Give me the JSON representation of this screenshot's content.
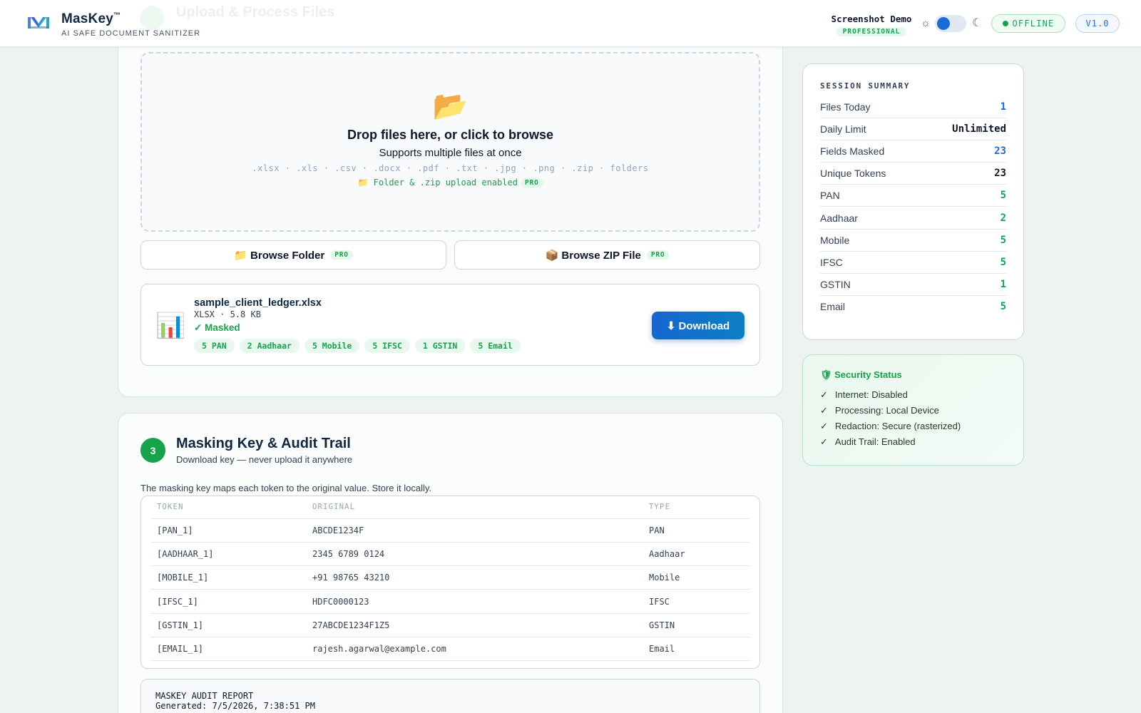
{
  "header": {
    "brand_name": "MasKey",
    "brand_tm": "™",
    "tagline": "AI SAFE DOCUMENT SANITIZER",
    "user_name": "Screenshot Demo",
    "plan": "PROFESSIONAL",
    "theme_light_icon": "☼",
    "theme_dark_icon": "☾",
    "status": "OFFLINE",
    "version": "V1.0"
  },
  "upload": {
    "ghost_title": "Upload & Process Files",
    "folder_icon": "📂",
    "drop_title": "Drop files here, or click to browse",
    "drop_sub": "Supports multiple files at once",
    "types": ".xlsx · .xls · .csv · .docx · .pdf · .txt · .jpg · .png · .zip · folders",
    "pro_note": "📁 Folder & .zip upload enabled",
    "pro_label": "PRO",
    "browse_folder": "📁 Browse Folder",
    "browse_zip": "📦 Browse ZIP File"
  },
  "file": {
    "icon": "📊",
    "name": "sample_client_ledger.xlsx",
    "meta": "XLSX · 5.8 KB",
    "status": "✓ Masked",
    "chips": [
      "5 PAN",
      "2 Aadhaar",
      "5 Mobile",
      "5 IFSC",
      "1 GSTIN",
      "5 Email"
    ],
    "download": "⬇ Download"
  },
  "step3": {
    "number": "3",
    "title": "Masking Key & Audit Trail",
    "subtitle": "Download key — never upload it anywhere",
    "description": "The masking key maps each token to the original value. Store it locally.",
    "columns": [
      "TOKEN",
      "ORIGINAL",
      "TYPE"
    ],
    "rows": [
      [
        "[PAN_1]",
        "ABCDE1234F",
        "PAN"
      ],
      [
        "[AADHAAR_1]",
        "2345 6789 0124",
        "Aadhaar"
      ],
      [
        "[MOBILE_1]",
        "+91 98765 43210",
        "Mobile"
      ],
      [
        "[IFSC_1]",
        "HDFC0000123",
        "IFSC"
      ],
      [
        "[GSTIN_1]",
        "27ABCDE1234F1Z5",
        "GSTIN"
      ],
      [
        "[EMAIL_1]",
        "rajesh.agarwal@example.com",
        "Email"
      ]
    ],
    "audit_line1": "MASKEY AUDIT REPORT",
    "audit_line2": "Generated: 7/5/2026, 7:38:51 PM"
  },
  "summary": {
    "title": "SESSION SUMMARY",
    "rows": [
      {
        "label": "Files Today",
        "value": "1",
        "color": "blue"
      },
      {
        "label": "Daily Limit",
        "value": "Unlimited",
        "color": "dark"
      },
      {
        "label": "Fields Masked",
        "value": "23",
        "color": "blue"
      },
      {
        "label": "Unique Tokens",
        "value": "23",
        "color": "dark"
      },
      {
        "label": "PAN",
        "value": "5",
        "color": "green"
      },
      {
        "label": "Aadhaar",
        "value": "2",
        "color": "green"
      },
      {
        "label": "Mobile",
        "value": "5",
        "color": "green"
      },
      {
        "label": "IFSC",
        "value": "5",
        "color": "green"
      },
      {
        "label": "GSTIN",
        "value": "1",
        "color": "green"
      },
      {
        "label": "Email",
        "value": "5",
        "color": "green"
      }
    ]
  },
  "security": {
    "title": "🛡 Security Status",
    "check": "✓",
    "items": [
      "Internet: Disabled",
      "Processing: Local Device",
      "Redaction: Secure (rasterized)",
      "Audit Trail: Enabled"
    ]
  },
  "colors": {
    "accent_blue": "#1a6dd8",
    "accent_green": "#16a34a",
    "brand_navy": "#0f2744"
  }
}
